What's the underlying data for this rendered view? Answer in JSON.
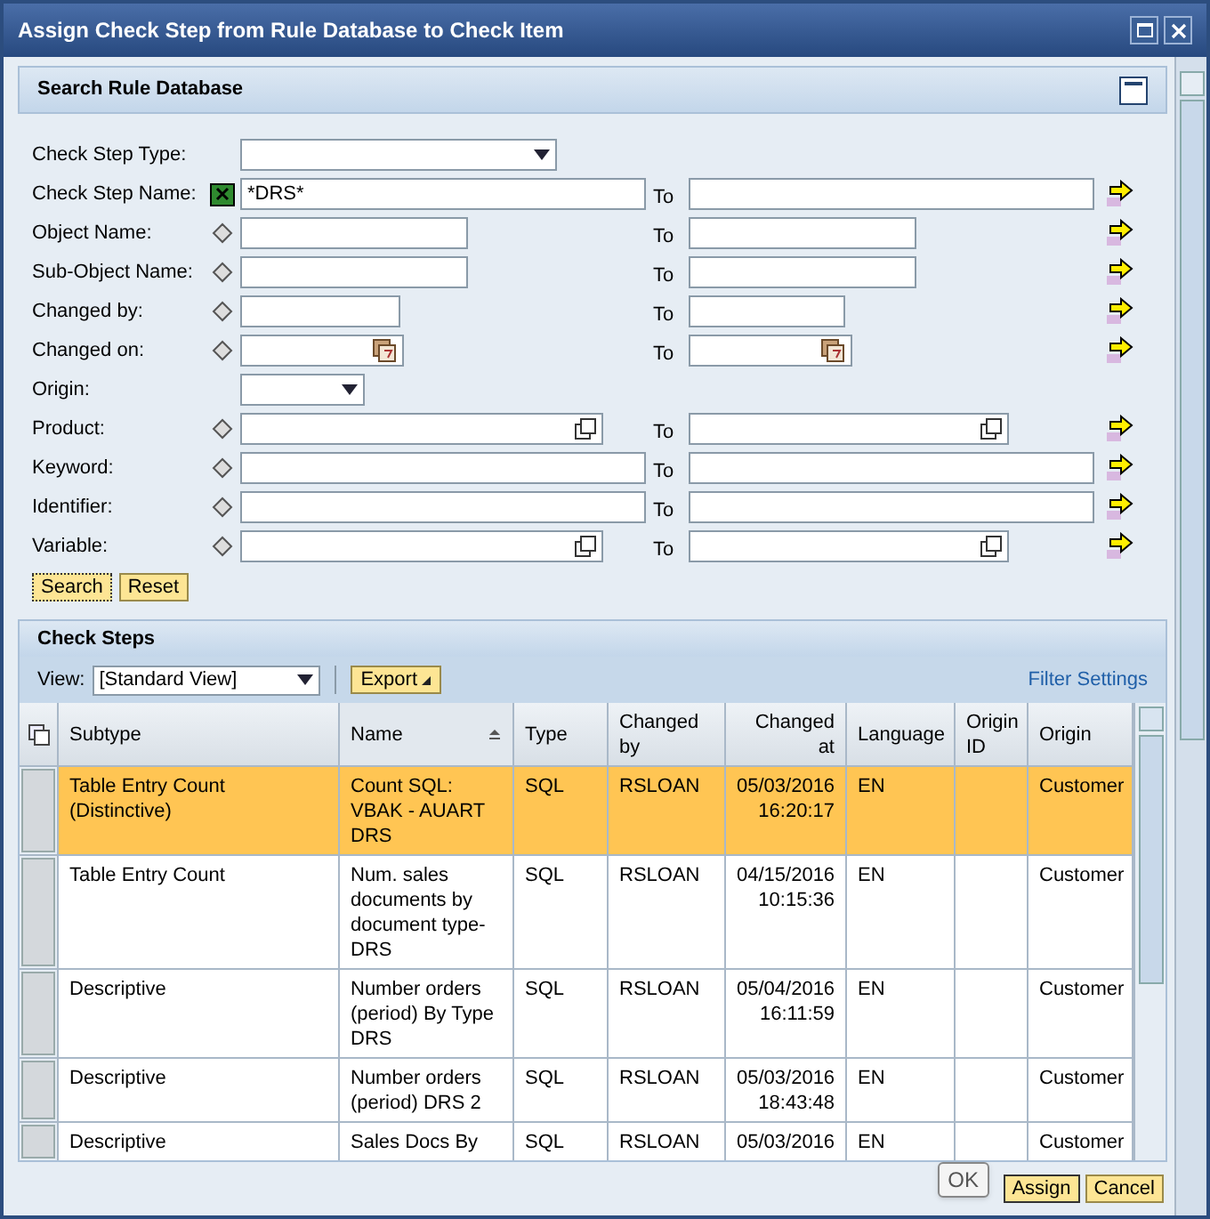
{
  "window": {
    "title": "Assign Check Step from Rule Database to Check Item"
  },
  "search_panel": {
    "title": "Search Rule Database",
    "expanded": true,
    "fields": [
      {
        "label": "Check Step Type:",
        "kind": "select_long",
        "range": false,
        "has_option": false
      },
      {
        "label": "Check Step Name:",
        "kind": "text_long",
        "range": true,
        "has_option": true,
        "pattern": true,
        "value": "*DRS*",
        "to_label": "To"
      },
      {
        "label": "Object Name:",
        "kind": "text_medium",
        "range": true,
        "has_option": true,
        "pattern": false,
        "to_label": "To"
      },
      {
        "label": "Sub-Object Name:",
        "kind": "text_medium",
        "range": true,
        "has_option": true,
        "pattern": false,
        "to_label": "To"
      },
      {
        "label": "Changed by:",
        "kind": "text_short",
        "range": true,
        "has_option": true,
        "pattern": false,
        "to_label": "To"
      },
      {
        "label": "Changed on:",
        "kind": "date",
        "range": true,
        "has_option": true,
        "pattern": false,
        "to_label": "To"
      },
      {
        "label": "Origin:",
        "kind": "select_short",
        "range": false,
        "has_option": false
      },
      {
        "label": "Product:",
        "kind": "help",
        "range": true,
        "has_option": true,
        "pattern": false,
        "to_label": "To"
      },
      {
        "label": "Keyword:",
        "kind": "text_long",
        "range": true,
        "has_option": true,
        "pattern": false,
        "to_label": "To"
      },
      {
        "label": "Identifier:",
        "kind": "text_long",
        "range": true,
        "has_option": true,
        "pattern": false,
        "to_label": "To"
      },
      {
        "label": "Variable:",
        "kind": "help",
        "range": true,
        "has_option": true,
        "pattern": false,
        "to_label": "To"
      }
    ],
    "buttons": [
      "Search",
      "Reset"
    ]
  },
  "results": {
    "title": "Check Steps",
    "view_label": "View:",
    "view_value": "[Standard View]",
    "export_button": "Export",
    "filter_link": "Filter Settings",
    "columns": [
      {
        "label": "Subtype",
        "sorted": false
      },
      {
        "label": "Name",
        "sorted": true
      },
      {
        "label": "Type",
        "sorted": false
      },
      {
        "label": "Changed by",
        "sorted": false
      },
      {
        "label": "Changed at",
        "sorted": false
      },
      {
        "label": "Language",
        "sorted": false
      },
      {
        "label": "Origin ID",
        "sorted": false
      },
      {
        "label": "Origin",
        "sorted": false
      }
    ],
    "rows": [
      {
        "selected": true,
        "cells": [
          "Table Entry Count (Distinctive)",
          "Count SQL: VBAK - AUART DRS",
          "SQL",
          "RSLOAN",
          "05/03/2016 16:20:17",
          "EN",
          "",
          "Customer"
        ]
      },
      {
        "selected": false,
        "cells": [
          "Table Entry Count",
          "Num. sales documents by document type-DRS",
          "SQL",
          "RSLOAN",
          "04/15/2016 10:15:36",
          "EN",
          "",
          "Customer"
        ]
      },
      {
        "selected": false,
        "cells": [
          "Descriptive",
          "Number orders (period) By Type DRS",
          "SQL",
          "RSLOAN",
          "05/04/2016 16:11:59",
          "EN",
          "",
          "Customer"
        ]
      },
      {
        "selected": false,
        "cells": [
          "Descriptive",
          "Number orders (period) DRS 2",
          "SQL",
          "RSLOAN",
          "05/03/2016 18:43:48",
          "EN",
          "",
          "Customer"
        ]
      },
      {
        "selected": false,
        "cells": [
          "Descriptive",
          "Sales Docs By",
          "SQL",
          "RSLOAN",
          "05/03/2016",
          "EN",
          "",
          "Customer"
        ]
      }
    ]
  },
  "footer": {
    "buttons": [
      "Assign",
      "Cancel"
    ],
    "tooltip": "OK"
  }
}
